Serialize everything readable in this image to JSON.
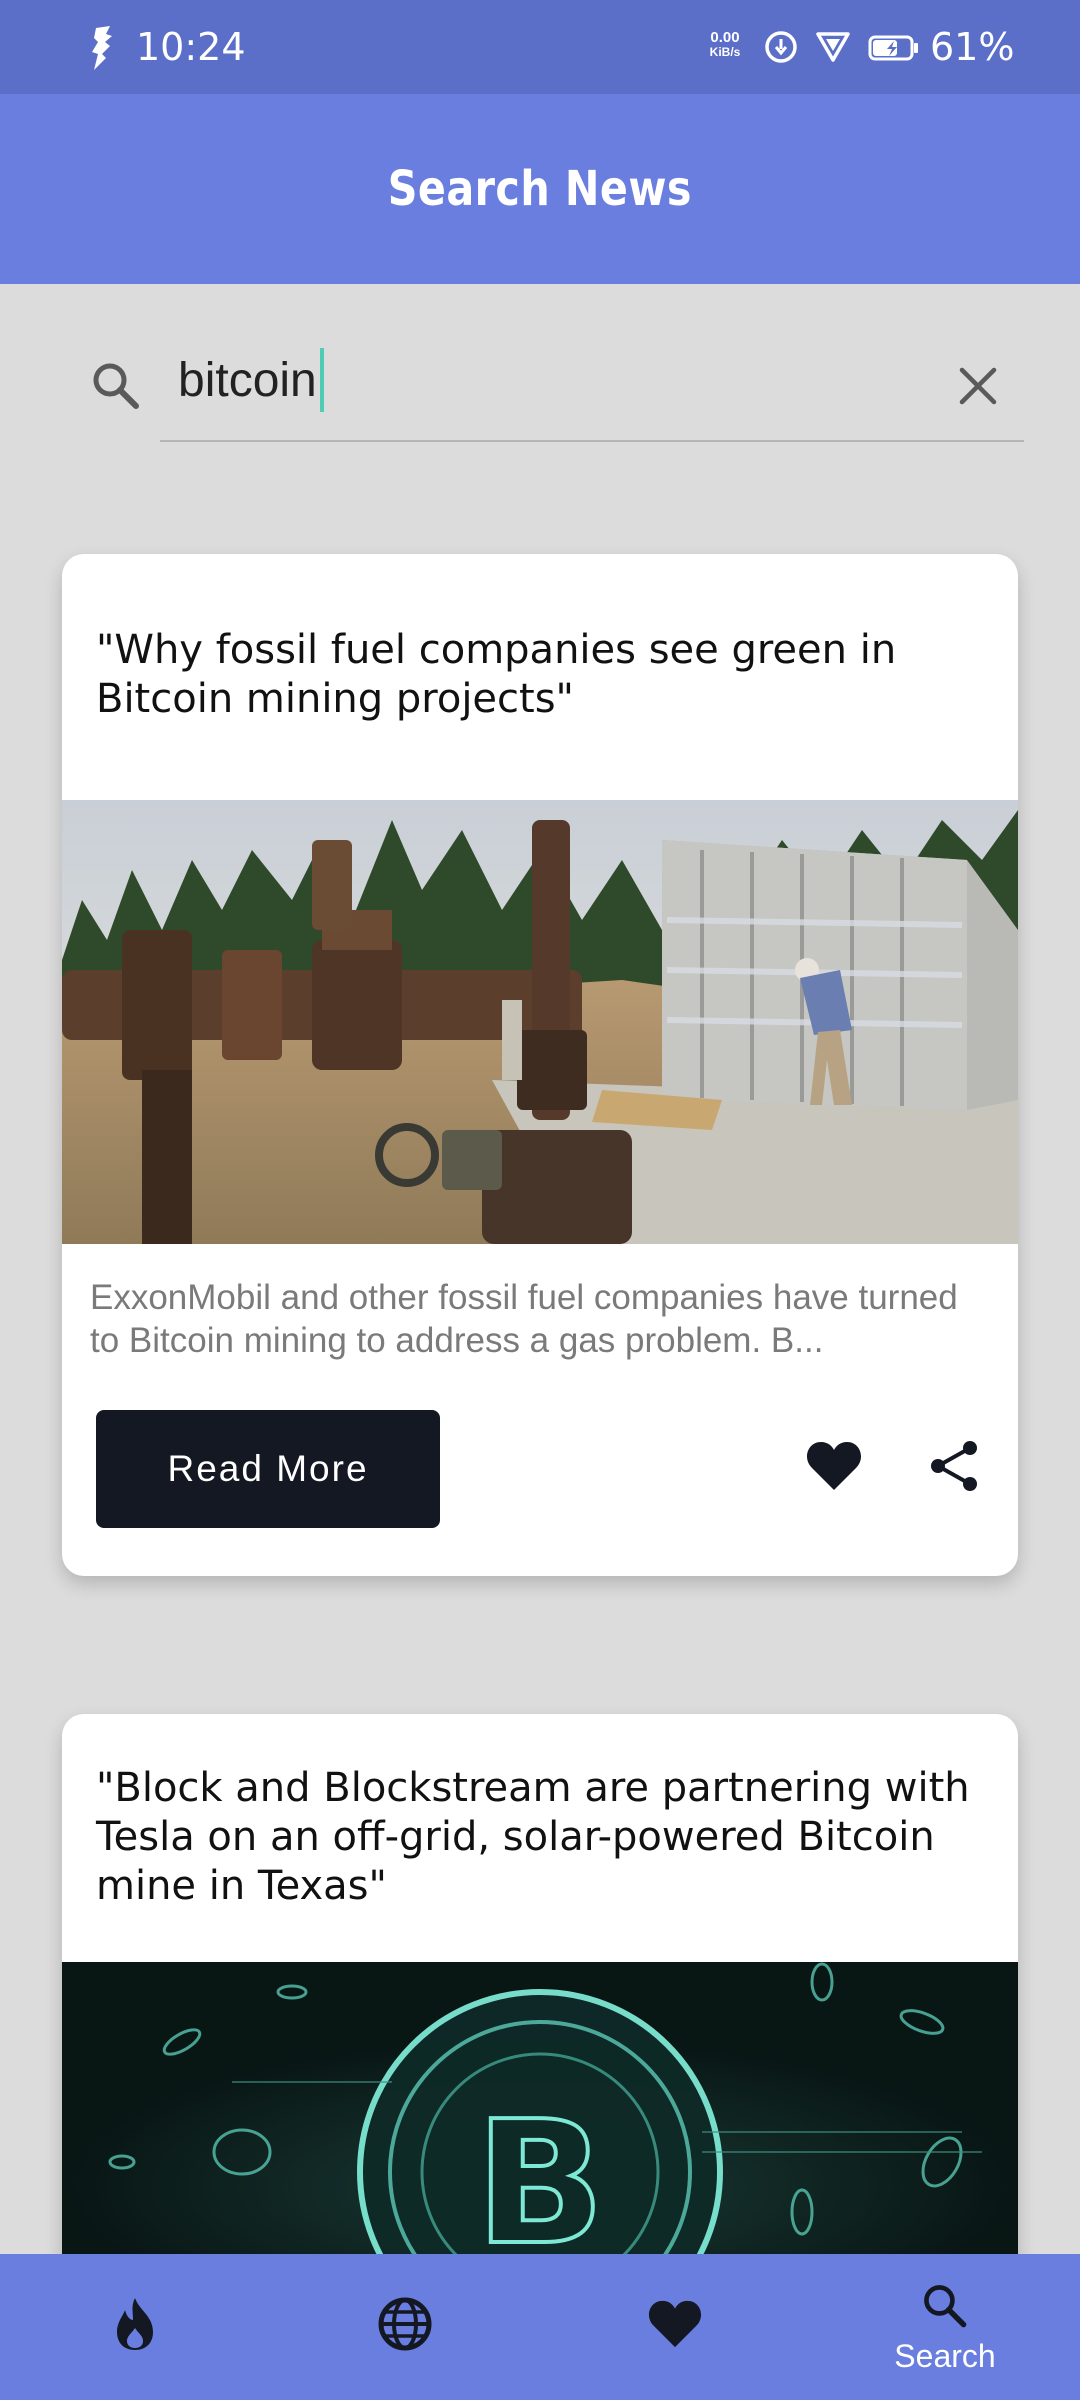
{
  "status_bar": {
    "time": "10:24",
    "net_speed_value": "0.00",
    "net_speed_unit": "KiB/s",
    "battery_percent": "61%"
  },
  "header": {
    "title": "Search News"
  },
  "search": {
    "query": "bitcoin",
    "placeholder": ""
  },
  "articles": [
    {
      "title": "\"Why fossil fuel companies see green in Bitcoin mining projects\"",
      "summary": "ExxonMobil and other fossil fuel companies have turned to Bitcoin mining to address a gas problem. B...",
      "read_more_label": "Read More",
      "liked": true
    },
    {
      "title": "\"Block and Blockstream are partnering with Tesla on an off-grid, solar-powered Bitcoin mine in Texas\""
    }
  ],
  "bottom_nav": {
    "items": [
      {
        "icon": "flame-icon",
        "label": ""
      },
      {
        "icon": "globe-icon",
        "label": ""
      },
      {
        "icon": "heart-icon",
        "label": ""
      },
      {
        "icon": "search-icon",
        "label": "Search"
      }
    ],
    "active_index": 3
  },
  "colors": {
    "status_bar": "#5b6ec8",
    "header": "#6a7ee0",
    "background": "#dcdcdc",
    "button": "#141822",
    "cursor": "#4ecdb4"
  }
}
